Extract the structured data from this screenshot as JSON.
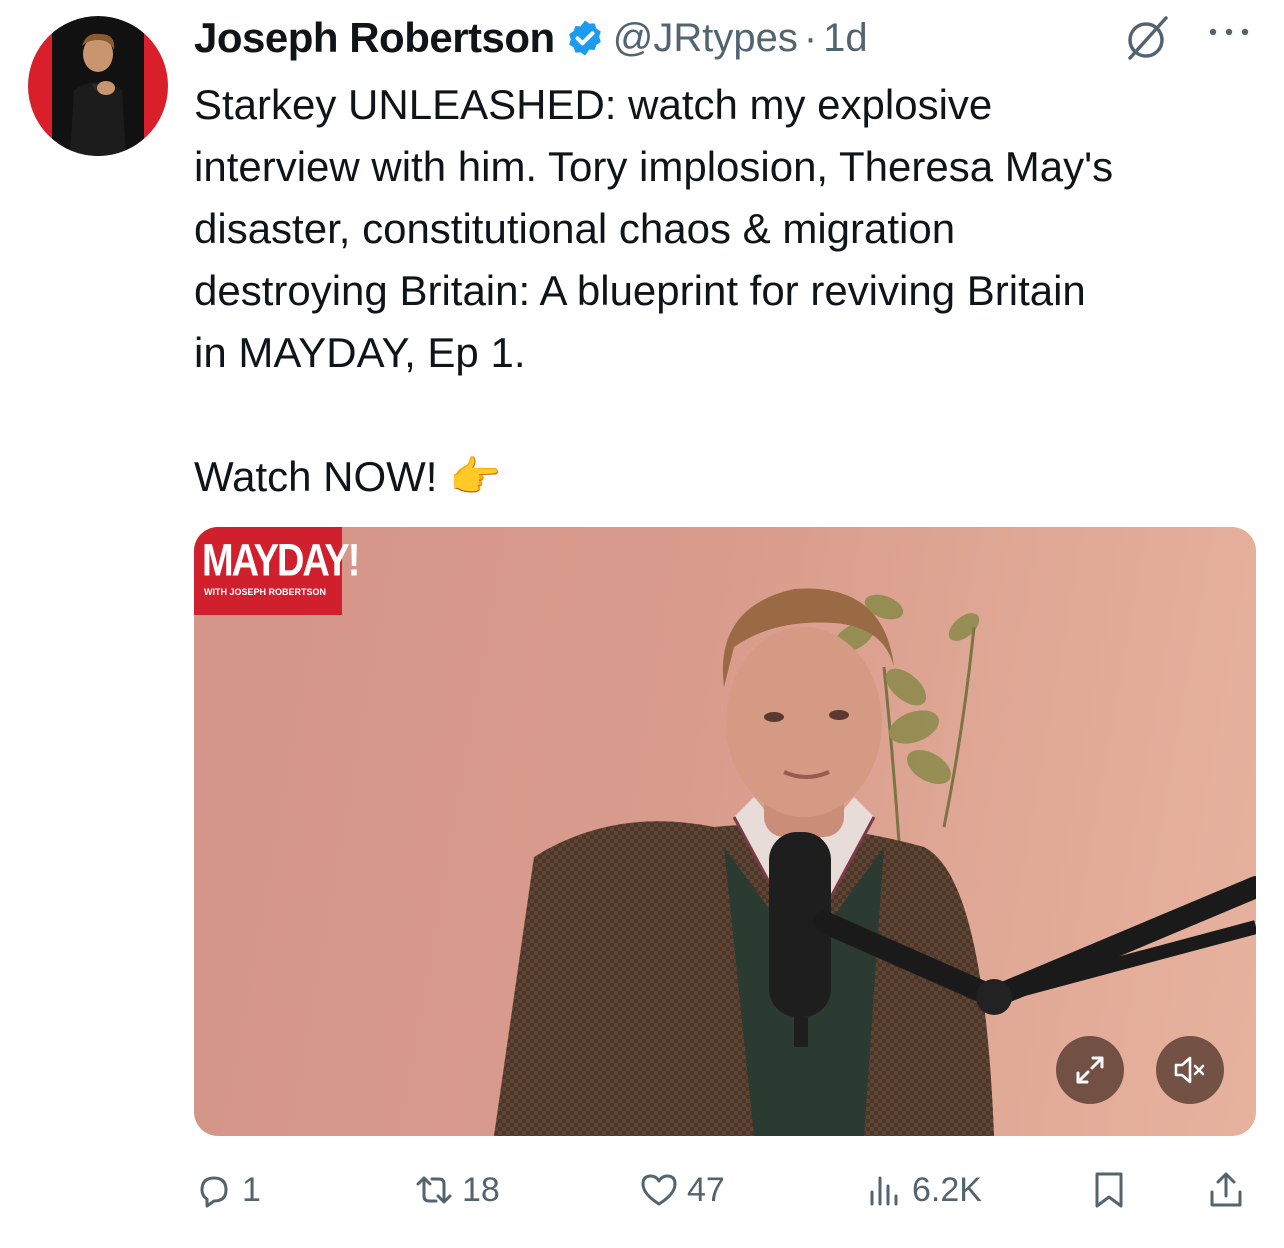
{
  "author": {
    "name": "Joseph Robertson",
    "handle": "@JRtypes",
    "separator": "·",
    "time": "1d",
    "verified_color": "#1d9bf0"
  },
  "tweet": {
    "text": "Starkey UNLEASHED: watch my explosive\ninterview with him. Tory implosion, Theresa May's\ndisaster, constitutional chaos & migration\ndestroying Britain: A blueprint for reviving Britain\nin MAYDAY, Ep 1.\n\nWatch NOW! 👉"
  },
  "media": {
    "logo_title": "MAYDAY!",
    "logo_subtitle": "WITH JOSEPH ROBERTSON",
    "logo_color": "#d0202e",
    "icons": [
      "expand-icon",
      "mute-icon"
    ]
  },
  "actions": {
    "replies": "1",
    "reposts": "18",
    "likes": "47",
    "views": "6.2K",
    "icons": [
      "reply-icon",
      "repost-icon",
      "like-icon",
      "views-icon",
      "bookmark-icon",
      "share-icon"
    ]
  },
  "colors": {
    "text": "#0f1419",
    "muted": "#536471",
    "accent": "#1d9bf0"
  }
}
